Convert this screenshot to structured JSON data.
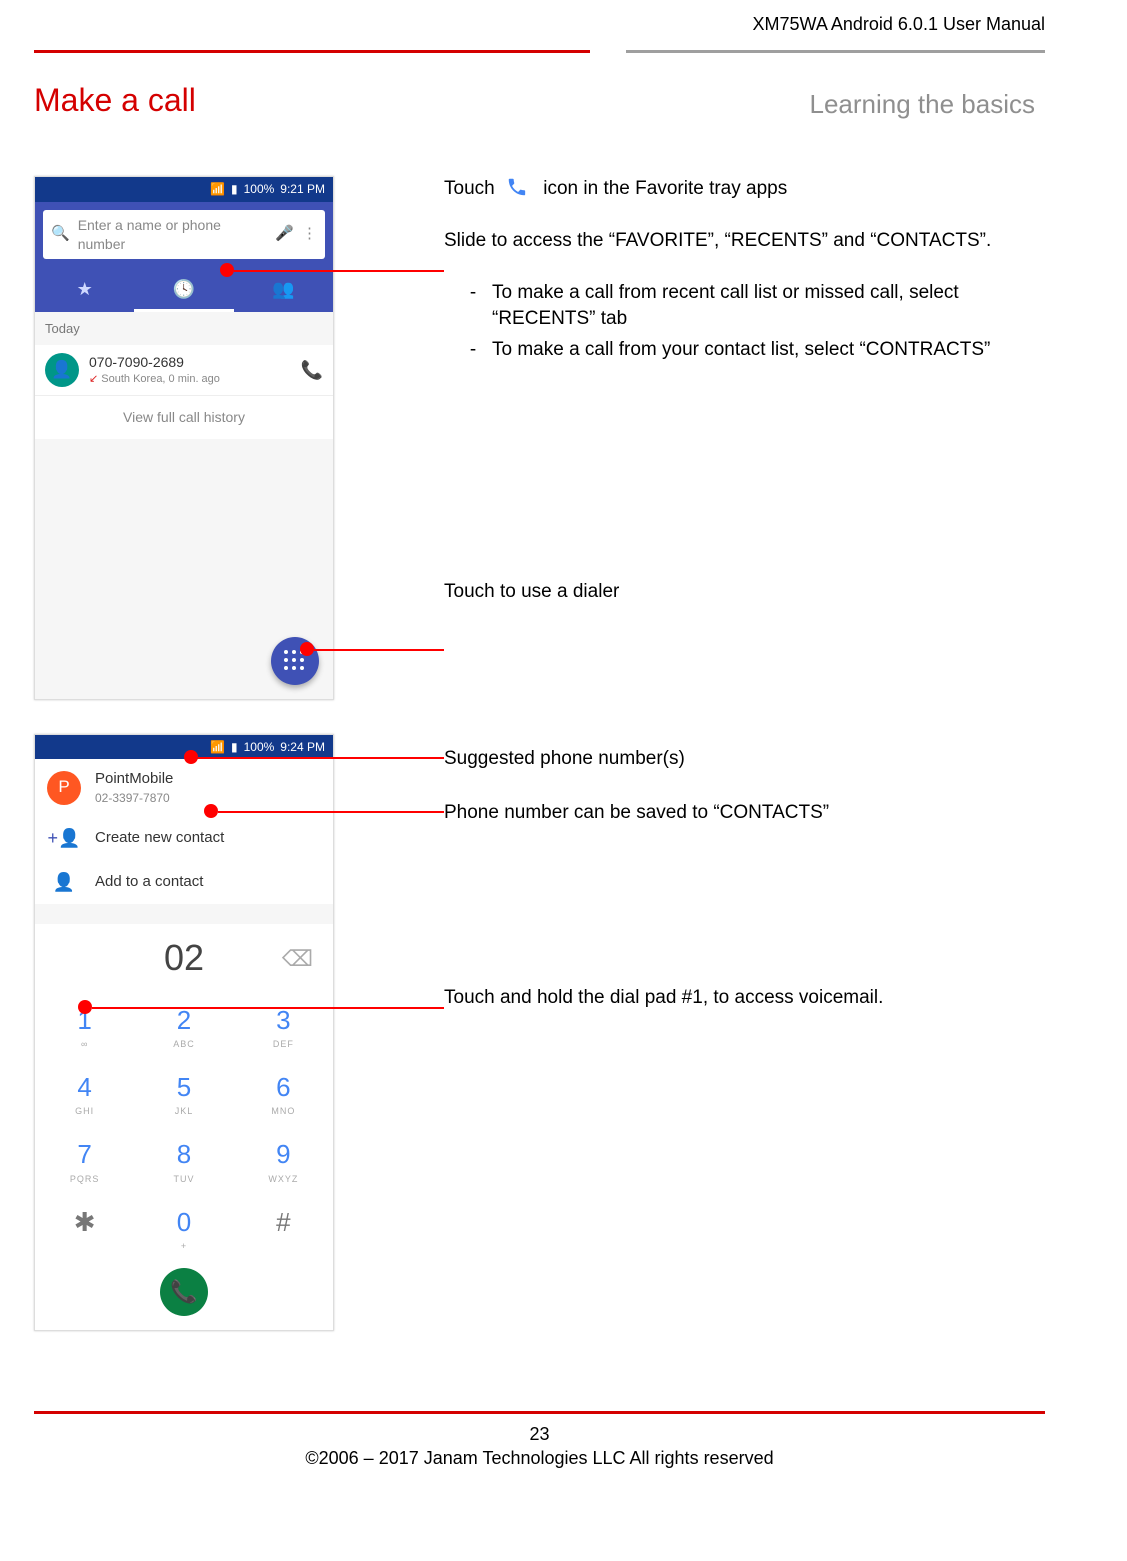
{
  "header": {
    "doc_title": "XM75WA Android 6.0.1 User Manual"
  },
  "titles": {
    "main": "Make a call",
    "sub": "Learning the basics"
  },
  "phone1": {
    "status": {
      "battery": "100%",
      "time": "9:21 PM"
    },
    "search_placeholder": "Enter a name or phone number",
    "section": "Today",
    "call_number": "070-7090-2689",
    "call_sub": "South Korea, 0 min. ago",
    "history": "View full call history"
  },
  "instr": {
    "touch_pre": "Touch ",
    "touch_post": " icon in the Favorite tray apps",
    "slide": "Slide to access the “FAVORITE”, “RECENTS” and “CONTACTS”.",
    "li1": "To make a call from recent call list or missed call, select “RECENTS” tab",
    "li2": "To make a call from your contact list, select “CONTRACTS”",
    "dialer": "Touch to use a dialer",
    "suggest": "Suggested phone number(s)",
    "save": "Phone number can be saved to “CONTACTS”",
    "vm": "Touch and hold the dial pad #1, to access voicemail."
  },
  "phone2": {
    "status": {
      "battery": "100%",
      "time": "9:24 PM"
    },
    "suggest_name": "PointMobile",
    "suggest_num": "02-3397-7870",
    "create": "Create new contact",
    "add": "Add to a contact",
    "dialed": "02",
    "keys": {
      "k1d": "1",
      "k1l": "∞",
      "k2d": "2",
      "k2l": "ABC",
      "k3d": "3",
      "k3l": "DEF",
      "k4d": "4",
      "k4l": "GHI",
      "k5d": "5",
      "k5l": "JKL",
      "k6d": "6",
      "k6l": "MNO",
      "k7d": "7",
      "k7l": "PQRS",
      "k8d": "8",
      "k8l": "TUV",
      "k9d": "9",
      "k9l": "WXYZ",
      "ks": "✱",
      "k0d": "0",
      "k0l": "+",
      "kh": "#"
    }
  },
  "footer": {
    "page": "23",
    "copy": "©2006 – 2017 Janam Technologies LLC All rights reserved"
  }
}
